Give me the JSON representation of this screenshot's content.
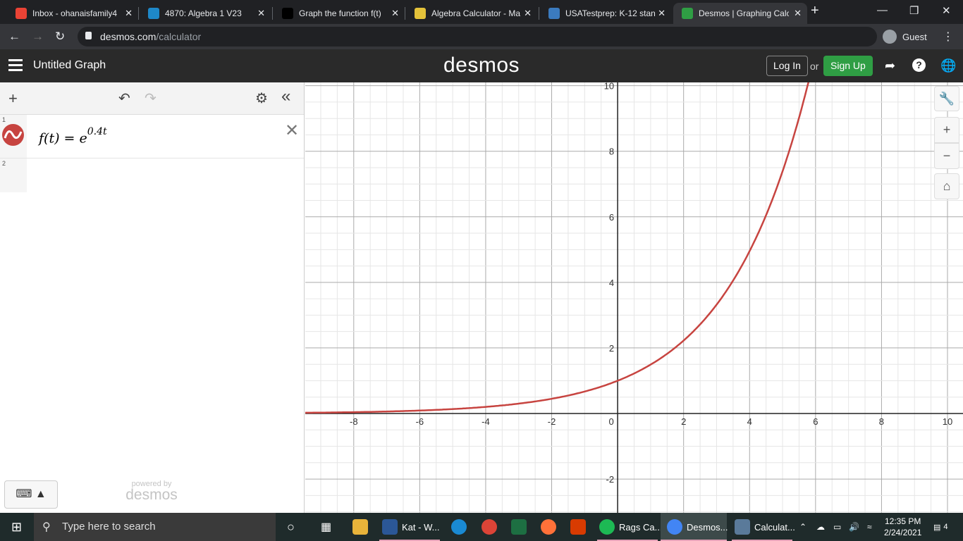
{
  "browser": {
    "tabs": [
      {
        "title": "Inbox - ohanaisfamily4",
        "color": "#ea4335",
        "active": false
      },
      {
        "title": "4870: Algebra 1 V23",
        "color": "#1e88c8",
        "active": false
      },
      {
        "title": "Graph the function f(t)",
        "color": "#000000",
        "active": false
      },
      {
        "title": "Algebra Calculator - Ma",
        "color": "#e4c23a",
        "active": false
      },
      {
        "title": "USATestprep: K-12 stan",
        "color": "#3b7bbf",
        "active": false
      },
      {
        "title": "Desmos | Graphing Calc",
        "color": "#2f9e44",
        "active": true
      }
    ],
    "new_tab": "+",
    "url_host": "desmos.com",
    "url_path": "/calculator",
    "profile": "Guest"
  },
  "desmos": {
    "graph_title": "Untitled Graph",
    "logo": "desmos",
    "login": "Log In",
    "or": "or",
    "signup": "Sign Up",
    "expressions": [
      {
        "index": "1",
        "lhs": "f(t) = e",
        "exponent": "0.4t",
        "color": "#c74440"
      },
      {
        "index": "2"
      }
    ],
    "powered_by": "powered by",
    "powered_logo": "desmos"
  },
  "graph": {
    "xlim": [
      -9.47,
      10.47
    ],
    "ylim": [
      -3.03,
      10.1
    ],
    "x_ticks": [
      "-8",
      "-6",
      "-4",
      "-2",
      "0",
      "2",
      "4",
      "6",
      "8",
      "10"
    ],
    "y_ticks": [
      "10",
      "8",
      "6",
      "4",
      "2",
      "-2"
    ],
    "curve": {
      "expr": "e^(0.4t)",
      "k": 0.4,
      "color": "#c74440"
    }
  },
  "taskbar": {
    "search_placeholder": "Type here to search",
    "apps": [
      {
        "label": "Kat - W...",
        "color": "#2b5797"
      },
      {
        "label": "Rags Ca...",
        "color": "#1db954"
      },
      {
        "label": "Desmos...",
        "color": "#4285f4"
      },
      {
        "label": "Calculat...",
        "color": "#5a7a9a"
      }
    ],
    "time": "12:35 PM",
    "date": "2/24/2021",
    "notifications": "4"
  }
}
